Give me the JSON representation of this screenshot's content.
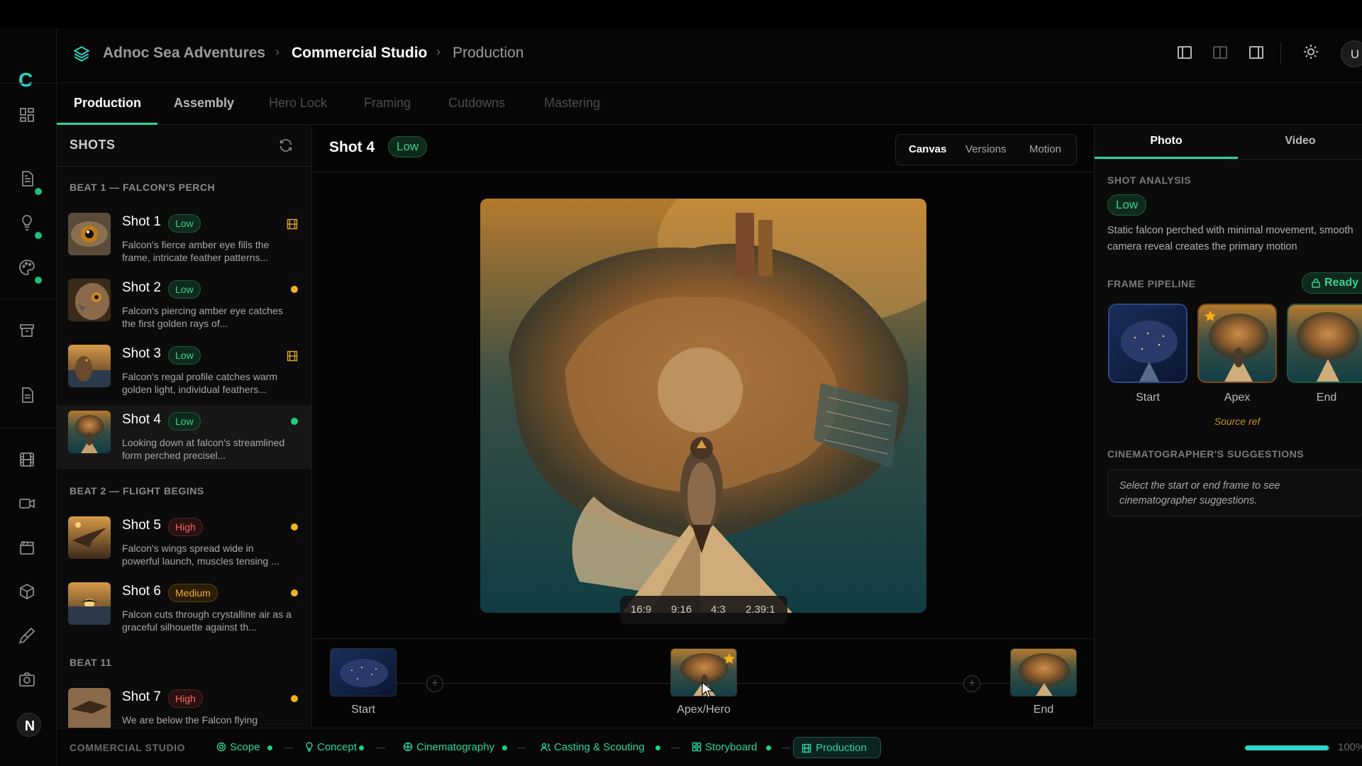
{
  "app": {
    "logo_letter": "C"
  },
  "breadcrumb": {
    "project": "Adnoc Sea Adventures",
    "studio": "Commercial Studio",
    "page": "Production"
  },
  "header": {
    "avatar_letter": "U"
  },
  "tabs": [
    "Production",
    "Assembly",
    "Hero Lock",
    "Framing",
    "Cutdowns",
    "Mastering"
  ],
  "shots_panel": {
    "title": "SHOTS",
    "beats": [
      "BEAT 1 — FALCON'S PERCH",
      "BEAT 2 — FLIGHT BEGINS",
      "BEAT 11"
    ],
    "shots": [
      {
        "title": "Shot 1",
        "complexity": "Low",
        "desc": "Falcon's fierce amber eye fills the frame, intricate feather patterns...",
        "indicator": "film-icon"
      },
      {
        "title": "Shot 2",
        "complexity": "Low",
        "desc": "Falcon's piercing amber eye catches the first golden rays of...",
        "indicator": "amber-dot"
      },
      {
        "title": "Shot 3",
        "complexity": "Low",
        "desc": "Falcon's regal profile catches warm golden light, individual feathers...",
        "indicator": "film-icon"
      },
      {
        "title": "Shot 4",
        "complexity": "Low",
        "desc": "Looking down at falcon's streamlined form perched precisel...",
        "indicator": "green-dot"
      },
      {
        "title": "Shot 5",
        "complexity": "High",
        "desc": "Falcon's wings spread wide in powerful launch, muscles tensing ...",
        "indicator": "amber-dot"
      },
      {
        "title": "Shot 6",
        "complexity": "Medium",
        "desc": "Falcon cuts through crystalline air as a graceful silhouette against th...",
        "indicator": "amber-dot"
      },
      {
        "title": "Shot 7",
        "complexity": "High",
        "desc": "We are below the Falcon flying",
        "indicator": "amber-dot"
      }
    ]
  },
  "canvas": {
    "shot_title": "Shot 4",
    "complexity": "Low",
    "view_modes": [
      "Canvas",
      "Versions",
      "Motion"
    ],
    "active_view": "Canvas",
    "aspect_ratios": [
      "16:9",
      "9:16",
      "4:3",
      "2.39:1"
    ],
    "timeline": [
      "Start",
      "Apex/Hero",
      "End"
    ]
  },
  "right_panel": {
    "tabs": [
      "Photo",
      "Video"
    ],
    "shot_analysis": {
      "title": "SHOT ANALYSIS",
      "complexity": "Low",
      "text": "Static falcon perched with minimal movement, smooth camera reveal creates the primary motion"
    },
    "frame_pipeline": {
      "title": "FRAME PIPELINE",
      "status": "Ready",
      "frames": [
        "Start",
        "Apex",
        "End"
      ],
      "source_note": "Source ref"
    },
    "suggestions": {
      "title": "CINEMATOGRAPHER'S SUGGESTIONS",
      "text": "Select the start or end frame to see cinematographer suggestions."
    }
  },
  "bottom_bar": {
    "label": "COMMERCIAL STUDIO",
    "steps": [
      "Scope",
      "Concept",
      "Cinematography",
      "Casting & Scouting",
      "Storyboard",
      "Production"
    ],
    "zoom": "100",
    "progress": 0.98
  },
  "colors": {
    "accent": "#2ad6a0",
    "low": "#3ad18a",
    "high": "#f06a6a",
    "medium": "#f0aa3a",
    "amber_dot": "#f5b019"
  }
}
